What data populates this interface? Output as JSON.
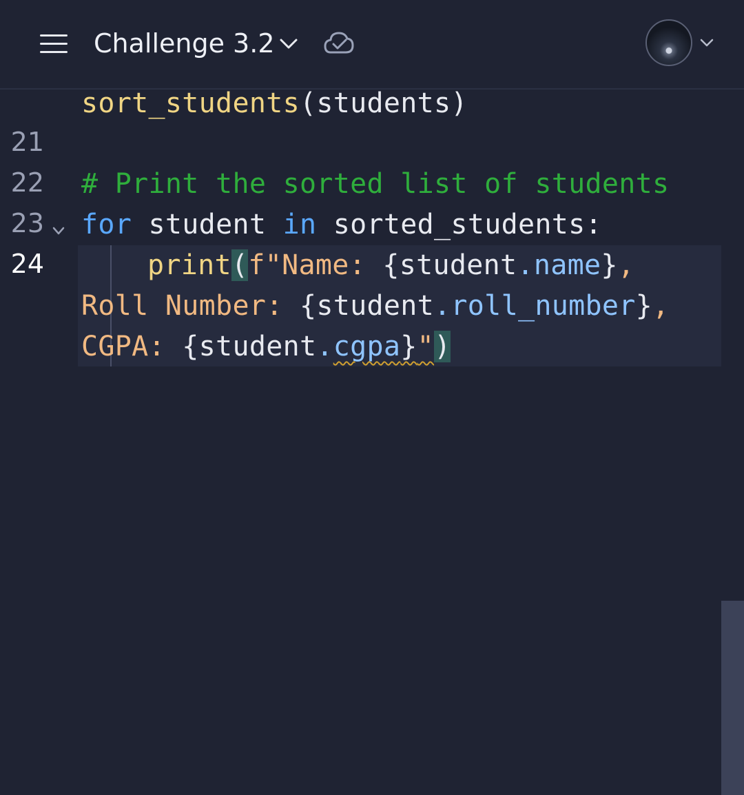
{
  "header": {
    "title": "Challenge 3.2",
    "icons": [
      "hamburger-menu-icon",
      "chevron-down-icon",
      "cloud-check-icon",
      "avatar",
      "chevron-down-icon"
    ]
  },
  "editor": {
    "line_top_fragment": {
      "fn": "sort_students",
      "rest": "(students)"
    },
    "lines": [
      {
        "number": "21"
      },
      {
        "number": "22",
        "comment": "# Print the sorted list of students"
      },
      {
        "number": "23",
        "kw_for": "for",
        "var": " student ",
        "kw_in": "in",
        "rest": " sorted_students:"
      },
      {
        "number": "24"
      }
    ],
    "print_line": {
      "fn": "print",
      "open_paren": "(",
      "fstr_start": "f\"Name: ",
      "brace1_open": "{student",
      "dot1": ".",
      "attr1": "name",
      "brace1_close": "}",
      "comma1": ",",
      "wrap1_str": "Roll Number: ",
      "brace2_open": "{student",
      "dot2": ".",
      "attr2": "roll_number",
      "brace2_close": "}",
      "comma2": ",",
      "wrap2_str": "CGPA: ",
      "brace3_open": "{student",
      "dot3": ".",
      "attr3": "cgpa",
      "brace3_close": "}",
      "quote_close": "\"",
      "close_paren": ")"
    }
  },
  "colors": {
    "background": "#1f2333",
    "function": "#f0d584",
    "keyword": "#5aa8ff",
    "comment": "#2fae3c",
    "string": "#f1b982",
    "attribute": "#8fc4ff"
  }
}
